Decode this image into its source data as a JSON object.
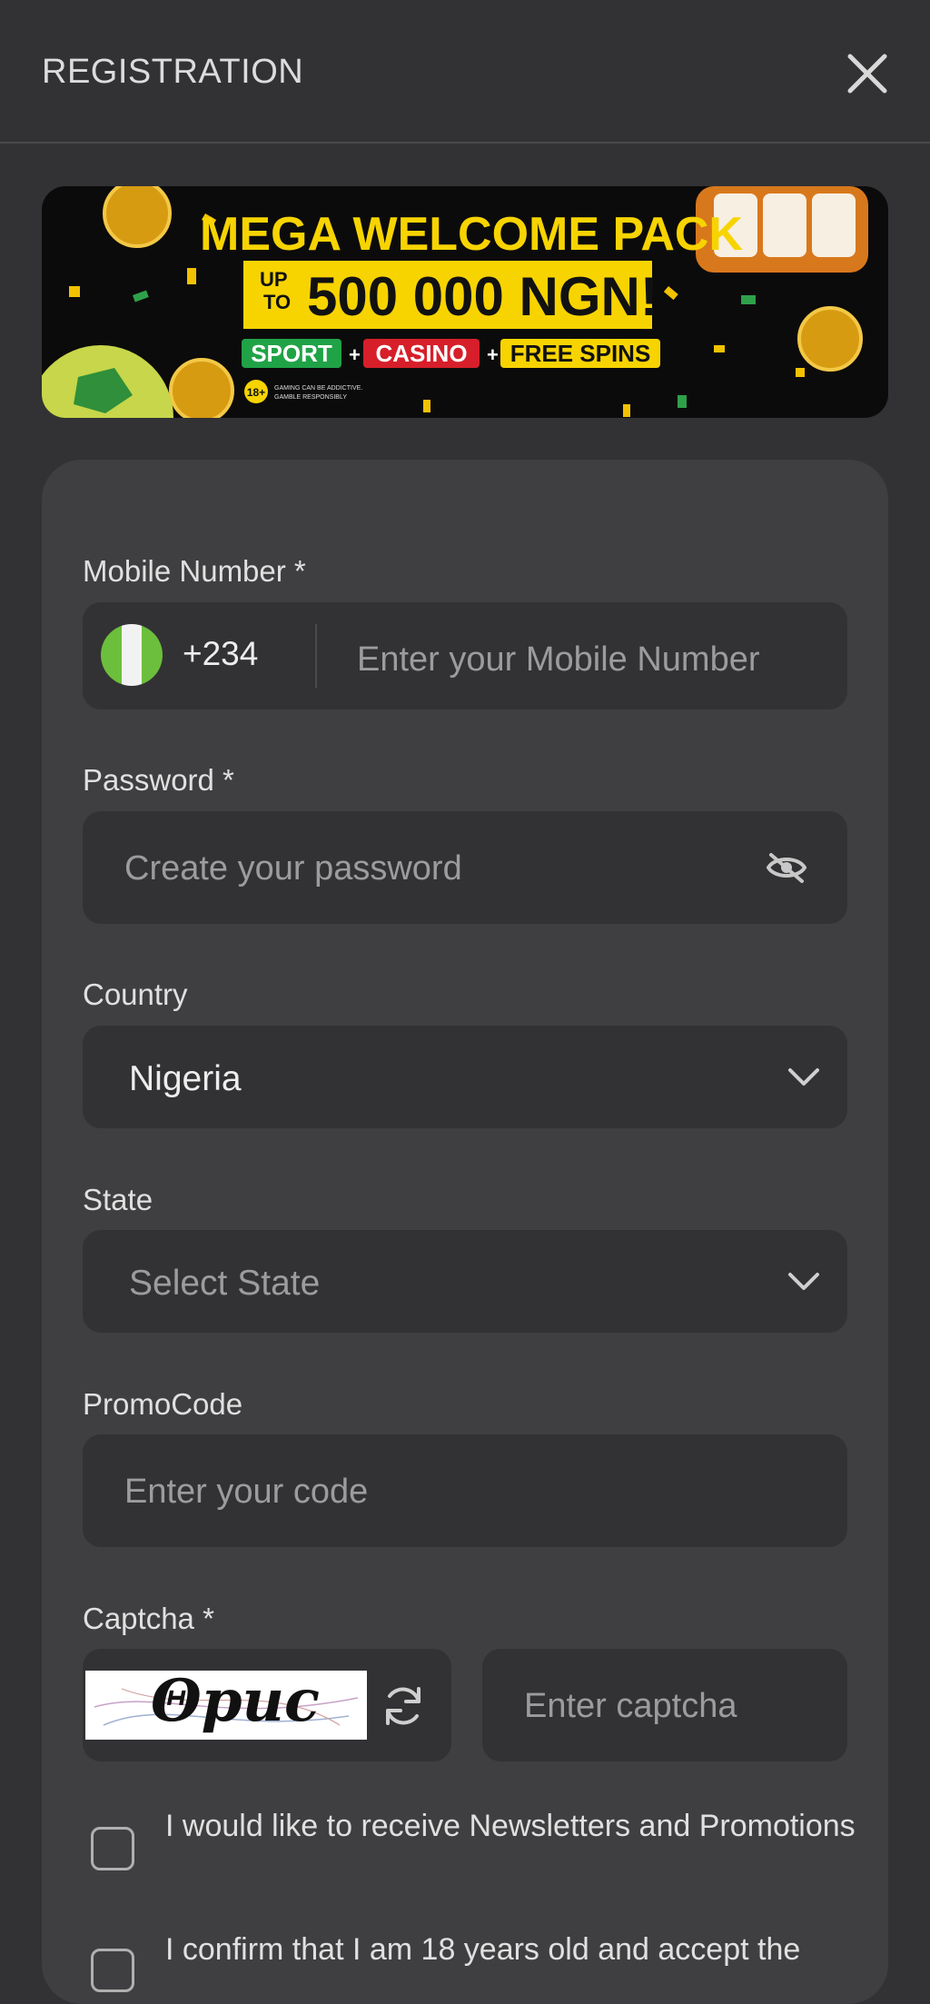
{
  "header": {
    "title": "REGISTRATION",
    "close_icon": "close-icon"
  },
  "banner": {
    "line1": "MEGA WELCOME PACK",
    "up_to": "UP TO",
    "amount": "500 000 NGN!",
    "tag_sport": "SPORT",
    "tag_casino": "CASINO",
    "tag_spins": "FREE SPINS",
    "age_badge": "18+",
    "disclaimer": "GAMING CAN BE ADDICTIVE. GAMBLE RESPONSIBLY"
  },
  "form": {
    "mobile": {
      "label": "Mobile Number *",
      "code": "+234",
      "placeholder": "Enter your Mobile Number"
    },
    "password": {
      "label": "Password *",
      "placeholder": "Create your password"
    },
    "country": {
      "label": "Country",
      "value": "Nigeria"
    },
    "state": {
      "label": "State",
      "placeholder": "Select State"
    },
    "promo": {
      "label": "PromoCode",
      "placeholder": "Enter your code"
    },
    "captcha": {
      "label": "Captcha *",
      "image_text": "Θpuc",
      "placeholder": "Enter captcha"
    },
    "newsletter": {
      "text": "I would like to receive Newsletters and Promotions"
    },
    "confirm": {
      "text": "I confirm that I am 18 years old and accept the"
    }
  },
  "colors": {
    "background": "#323234",
    "card": "#3f3f41",
    "field": "#323234",
    "flag_green": "#2ea44f"
  }
}
